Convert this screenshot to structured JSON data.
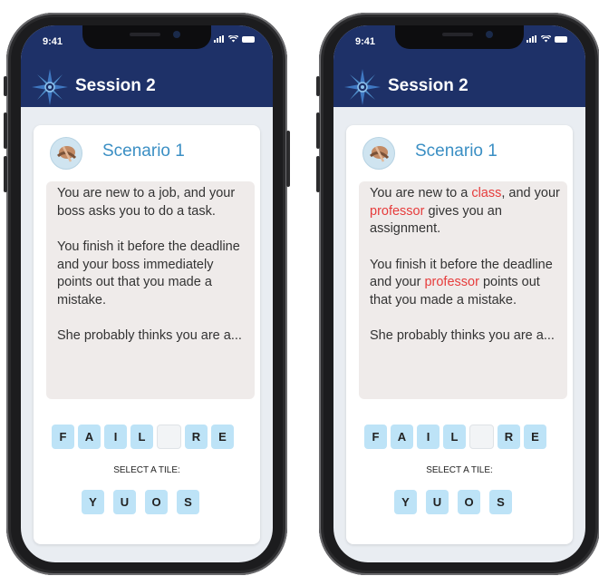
{
  "phones": [
    {
      "status_time": "9:41",
      "session_title": "Session 2",
      "scenario_title": "Scenario 1",
      "story_paragraphs": [
        [
          {
            "text": "You are new to a job, and your boss asks you to do a task.",
            "hl": false
          }
        ],
        [
          {
            "text": "You finish it before the deadline and your boss immediately points out that you made a mistake.",
            "hl": false
          }
        ],
        [
          {
            "text": "She probably thinks you are a...",
            "hl": false
          }
        ]
      ],
      "word_tiles": [
        "F",
        "A",
        "I",
        "L",
        "",
        "R",
        "E"
      ],
      "select_label": "SELECT A TILE:",
      "choice_tiles": [
        "Y",
        "U",
        "O",
        "S"
      ]
    },
    {
      "status_time": "9:41",
      "session_title": "Session 2",
      "scenario_title": "Scenario 1",
      "story_paragraphs": [
        [
          {
            "text": "You are new to a ",
            "hl": false
          },
          {
            "text": "class",
            "hl": true
          },
          {
            "text": ", and your ",
            "hl": false
          },
          {
            "text": "professor",
            "hl": true
          },
          {
            "text": " gives you an assignment.",
            "hl": false
          }
        ],
        [
          {
            "text": "You finish it before the deadline and your ",
            "hl": false
          },
          {
            "text": "professor",
            "hl": true
          },
          {
            "text": " points out that you made a mistake.",
            "hl": false
          }
        ],
        [
          {
            "text": "She probably thinks you are a...",
            "hl": false
          }
        ]
      ],
      "word_tiles": [
        "F",
        "A",
        "I",
        "L",
        "",
        "R",
        "E"
      ],
      "select_label": "SELECT A TILE:",
      "choice_tiles": [
        "Y",
        "U",
        "O",
        "S"
      ]
    }
  ],
  "colors": {
    "header": "#1e3168",
    "scenario_title": "#3b8fc4",
    "tile": "#bde3f7",
    "highlight": "#e63c3c",
    "story_bg": "#efebea"
  },
  "icons": [
    "compass-star-logo-icon",
    "scenario-avatar-icon",
    "signal-icon",
    "wifi-icon",
    "battery-icon"
  ]
}
